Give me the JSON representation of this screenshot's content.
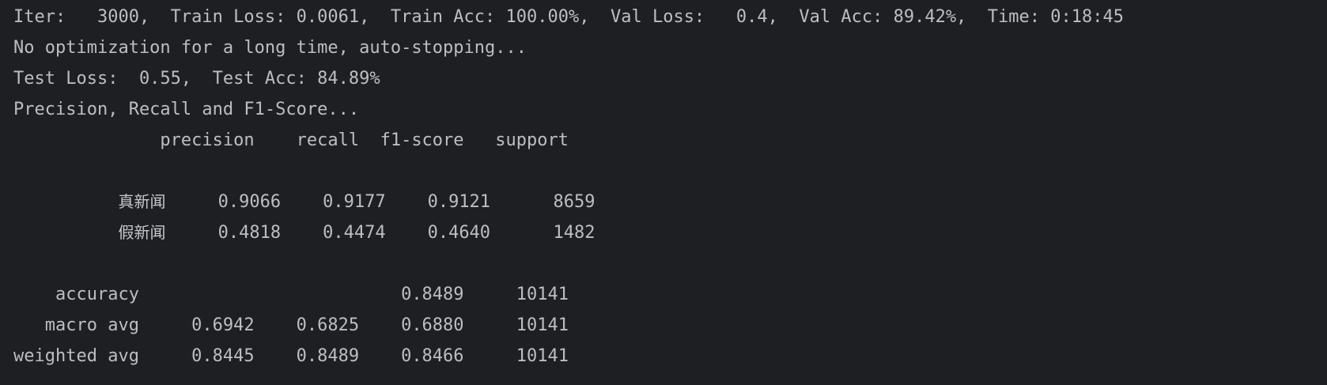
{
  "console": {
    "log_lines": [
      "Iter:   3000,  Train Loss: 0.0061,  Train Acc: 100.00%,  Val Loss:   0.4,  Val Acc: 89.42%,  Time: 0:18:45",
      "No optimization for a long time, auto-stopping...",
      "Test Loss:  0.55,  Test Acc: 84.89%",
      "Precision, Recall and F1-Score..."
    ],
    "report": {
      "header": "              precision    recall  f1-score   support",
      "rows": [
        {
          "label": "真新闻",
          "values": "     0.9066    0.9177    0.9121      8659"
        },
        {
          "label": "假新闻",
          "values": "     0.4818    0.4474    0.4640      1482"
        }
      ],
      "summary_rows": [
        "    accuracy                         0.8489     10141",
        "   macro avg     0.6942    0.6825    0.6880     10141",
        "weighted avg     0.8445    0.8489    0.8466     10141"
      ]
    }
  }
}
